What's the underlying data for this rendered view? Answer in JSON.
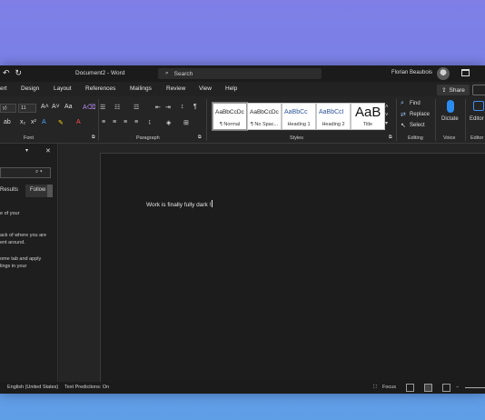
{
  "titlebar": {
    "doc_title": "Document2 - Word",
    "search_placeholder": "Search",
    "user_name": "Florian Beaubois",
    "undo_glyph": "↶",
    "redo_glyph": "↻"
  },
  "tabs": [
    "ert",
    "Design",
    "Layout",
    "References",
    "Mailings",
    "Review",
    "View",
    "Help"
  ],
  "share_label": "Share",
  "ribbon": {
    "font_box": "y)",
    "size_box": "11",
    "groups": {
      "font": "Font",
      "paragraph": "Paragraph",
      "styles": "Styles",
      "editing": "Editing",
      "voice": "Voice",
      "editor": "Editor"
    },
    "styles": [
      {
        "sample": "AaBbCcDc",
        "name": "¶ Normal"
      },
      {
        "sample": "AaBbCcDc",
        "name": "¶ No Spac..."
      },
      {
        "sample": "AaBbCc",
        "name": "Heading 1"
      },
      {
        "sample": "AaBbCcI",
        "name": "Heading 2"
      },
      {
        "sample": "AaB",
        "name": "Title"
      }
    ],
    "editing": {
      "find": "Find",
      "replace": "Replace",
      "select": "Select"
    },
    "dictate": "Dictate",
    "editor": "Editor"
  },
  "navpane": {
    "close_glyph": "✕",
    "dropdown_glyph": "▾",
    "tab_results": "Results",
    "tab_follow": "Follow",
    "lines": [
      "e of your",
      "ack of where you are",
      "ent around.",
      "ome tab and apply",
      "lings in your"
    ]
  },
  "document": {
    "body_text": "Work is finally fully dark !"
  },
  "statusbar": {
    "language": "English (United States)",
    "predictions": "Text Predictions: On",
    "focus": "Focus"
  },
  "colors": {
    "background_top": "#7f7fe6",
    "background_bottom": "#5f9fe6",
    "window_bg": "#1f1f1f",
    "accent": "#2b8cf0"
  }
}
